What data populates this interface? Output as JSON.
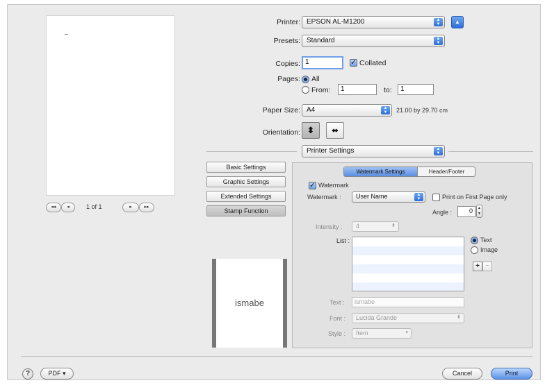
{
  "printer": {
    "label": "Printer:",
    "value": "EPSON AL-M1200"
  },
  "presets": {
    "label": "Presets:",
    "value": "Standard"
  },
  "copies": {
    "label": "Copies:",
    "value": "1",
    "collated_label": "Collated"
  },
  "pages": {
    "label": "Pages:",
    "all_label": "All",
    "from_label": "From:",
    "from_value": "1",
    "to_label": "to:",
    "to_value": "1"
  },
  "paper_size": {
    "label": "Paper Size:",
    "value": "A4",
    "dims": "21.00 by 29.70 cm"
  },
  "orientation": {
    "label": "Orientation:"
  },
  "panel_select": {
    "value": "Printer Settings"
  },
  "preview_nav": {
    "first": "◂◂",
    "prev": "◂",
    "page_info": "1 of 1",
    "next": "▸",
    "last": "▸▸"
  },
  "side_buttons": [
    "Basic Settings",
    "Graphic Settings",
    "Extended Settings",
    "Stamp Function"
  ],
  "tabs": {
    "watermark": "Watermark Settings",
    "header": "Header/Footer"
  },
  "watermark": {
    "check_label": "Watermark",
    "label": "Watermark :",
    "value": "User Name",
    "first_page_label": "Print on First Page only",
    "angle_label": "Angle :",
    "angle_value": "0",
    "intensity_label": "Intensity :",
    "intensity_value": "4",
    "list_label": "List :",
    "text_radio": "Text",
    "image_radio": "Image",
    "add": "+",
    "remove": "−",
    "text_label": "Text :",
    "text_value": "ismabe",
    "font_label": "Font :",
    "font_value": "Lucida Grande",
    "style_label": "Style :",
    "style_value": "Item"
  },
  "stamp_preview_text": "ismabe",
  "bottom": {
    "help": "?",
    "pdf": "PDF ▾",
    "cancel": "Cancel",
    "print": "Print"
  },
  "colors": {
    "accent": "#3b7be0",
    "panel": "#ebebeb"
  },
  "icons": {
    "help": "help-icon",
    "portrait": "portrait-orientation-icon",
    "landscape": "landscape-orientation-icon",
    "disclosure": "disclosure-triangle-icon"
  }
}
